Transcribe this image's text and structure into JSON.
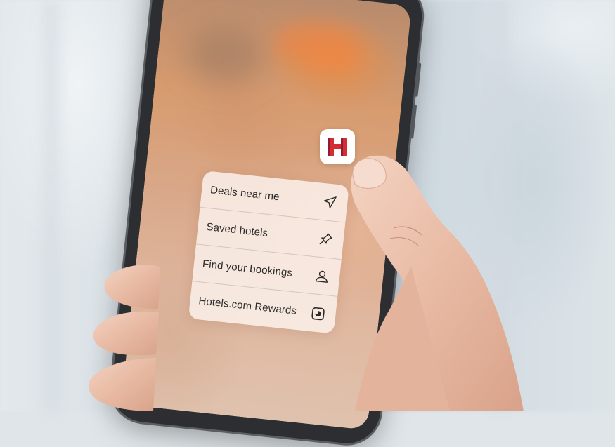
{
  "app": {
    "name": "Hotels.com",
    "icon_letter": "H",
    "brand_color": "#d32f2f"
  },
  "quick_actions": [
    {
      "label": "Deals near me",
      "icon": "location-arrow-icon"
    },
    {
      "label": "Saved hotels",
      "icon": "pin-icon"
    },
    {
      "label": "Find your bookings",
      "icon": "person-icon"
    },
    {
      "label": "Hotels.com Rewards",
      "icon": "rewards-icon"
    }
  ]
}
